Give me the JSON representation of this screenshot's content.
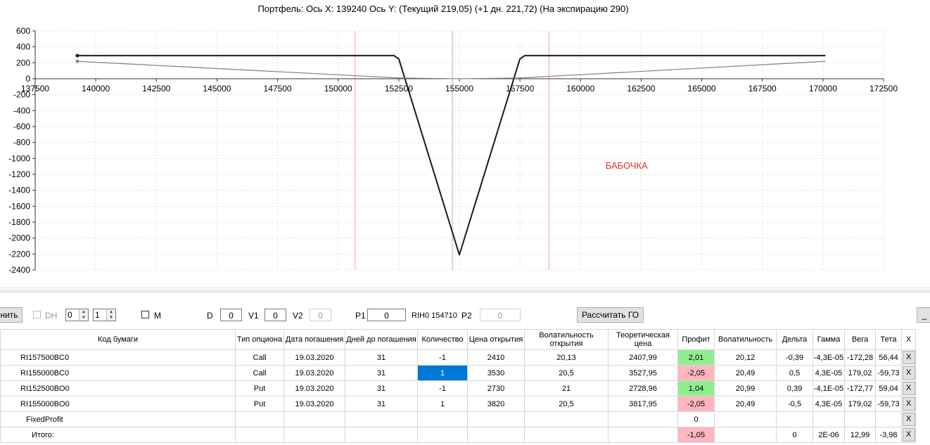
{
  "chart_data": {
    "type": "line",
    "title": "Портфель: Ось X: 139240 Ось Y:  (Текущий 219,05)  (+1 дн. 221,72)  (На экспирацию 290)",
    "annotation": "БАБОЧКА",
    "xlim": [
      137500,
      172500
    ],
    "ylim": [
      -2400,
      600
    ],
    "xticks": [
      "137500",
      "140000",
      "142500",
      "145000",
      "147500",
      "150000",
      "152500",
      "155000",
      "157500",
      "160000",
      "162500",
      "165000",
      "167500",
      "170000",
      "172500"
    ],
    "yticks": [
      "600",
      "400",
      "200",
      "0",
      "-200",
      "-400",
      "-600",
      "-800",
      "-1000",
      "-1200",
      "-1400",
      "-1600",
      "-1800",
      "-2000",
      "-2200",
      "-2400"
    ],
    "grid": true,
    "vlines": [
      {
        "x": 150700,
        "color": "#f4a6b0"
      },
      {
        "x": 154710,
        "color": "#a7b3c8"
      },
      {
        "x": 158700,
        "color": "#f4a6b0"
      }
    ],
    "series": [
      {
        "color": "#1a1a1a",
        "x": [
          139240,
          152300,
          152500,
          155000,
          157500,
          157700,
          170100
        ],
        "y": [
          290,
          290,
          250,
          -2210,
          250,
          290,
          290
        ]
      },
      {
        "color": "#8a8a8a",
        "x": [
          139240,
          152500,
          155000,
          157500,
          170100
        ],
        "y": [
          219,
          10,
          0,
          10,
          219
        ]
      }
    ]
  },
  "toolbar": {
    "left_button": "нить",
    "dh_label": "DH",
    "spin1_value": "0",
    "spin2_value": "1",
    "m_label": "M",
    "d_label": "D",
    "d_value": "0",
    "v1_label": "V1",
    "v1_value": "0",
    "v2_label": "V2",
    "v2_value": "0",
    "p1_label": "P1",
    "p1_value": "0",
    "ticker_text": "RIH0 154710",
    "p2_label": "P2",
    "p2_value": "0",
    "calc_button": "Рассчитать ГО",
    "min_button": "_"
  },
  "table": {
    "headers": [
      "Код бумаги",
      "Тип опциона",
      "Дата погашения",
      "Дней до погашения",
      "Количество",
      "Цена открытия",
      "Волатильность открытия",
      "Теоретическая цена",
      "Профит",
      "Волатильность",
      "Дельта",
      "Гамма",
      "Вега",
      "Тета",
      "X"
    ],
    "rows": [
      {
        "code": "RI157500BC0",
        "type": "Call",
        "date": "19.03.2020",
        "days": "31",
        "qty": "-1",
        "open": "2410",
        "vol_open": "20,13",
        "theo": "2407,99",
        "profit": "2,01",
        "vol": "20,12",
        "delta": "-0,39",
        "gamma": "-4,3E-05",
        "vega": "-172,28",
        "theta": "56,44",
        "x": "X"
      },
      {
        "code": "RI155000BC0",
        "type": "Call",
        "date": "19.03.2020",
        "days": "31",
        "qty": "1",
        "open": "3530",
        "vol_open": "20,5",
        "theo": "3527,95",
        "profit": "-2,05",
        "vol": "20,49",
        "delta": "0,5",
        "gamma": "4,3E-05",
        "vega": "179,02",
        "theta": "-59,73",
        "x": "X"
      },
      {
        "code": "RI152500BO0",
        "type": "Put",
        "date": "19.03.2020",
        "days": "31",
        "qty": "-1",
        "open": "2730",
        "vol_open": "21",
        "theo": "2728,96",
        "profit": "1,04",
        "vol": "20,99",
        "delta": "0,39",
        "gamma": "-4,1E-05",
        "vega": "-172,77",
        "theta": "59,04",
        "x": "X"
      },
      {
        "code": "RI155000BO0",
        "type": "Put",
        "date": "19.03.2020",
        "days": "31",
        "qty": "1",
        "open": "3820",
        "vol_open": "20,5",
        "theo": "3817,95",
        "profit": "-2,05",
        "vol": "20,49",
        "delta": "-0,5",
        "gamma": "4,3E-05",
        "vega": "179,02",
        "theta": "-59,73",
        "x": "X"
      }
    ],
    "fixed_row": {
      "label": "FixedProfit",
      "profit": "0",
      "x": "X"
    },
    "total_row": {
      "label": "Итого:",
      "profit": "-1,05",
      "delta": "0",
      "gamma": "2E-06",
      "vega": "12,99",
      "theta": "-3,98",
      "x": "X"
    }
  }
}
